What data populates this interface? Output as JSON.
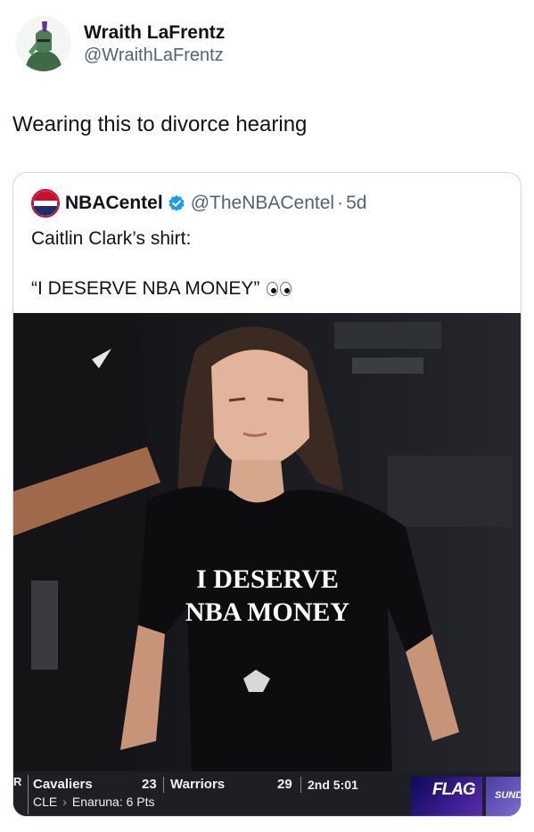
{
  "author": {
    "display_name": "Wraith LaFrentz",
    "handle": "@WraithLaFrentz",
    "avatar_icon": "knight-helmet-icon"
  },
  "tweet": {
    "text": "Wearing this to divorce hearing"
  },
  "quoted": {
    "display_name": "NBACentel",
    "handle": "@TheNBACentel",
    "separator": "·",
    "time": "5d",
    "verified_icon": "verified-badge-icon",
    "line1": "Caitlin Clark’s shirt:",
    "line2": "“I DESERVE NBA MONEY”",
    "emoji": "eyes-emoji-icon",
    "avatar_text": "CENTEL",
    "image": {
      "shirt_line1": "I DESERVE",
      "shirt_line2": "NBA MONEY",
      "nike_icon": "swoosh-icon",
      "scorebar": {
        "prefix": "R",
        "team1": "Cavaliers",
        "score1": "23",
        "team2": "Warriors",
        "score2": "29",
        "clock": "2nd 5:01",
        "sub_team": "CLE",
        "sub_detail": "Enaruna: 6 Pts",
        "brand": "FLAG",
        "brand2": "SUND"
      }
    }
  },
  "colors": {
    "text_primary": "#0f1419",
    "text_secondary": "#536471",
    "verified_blue": "#1d9bf0",
    "border": "#cfd9de"
  }
}
